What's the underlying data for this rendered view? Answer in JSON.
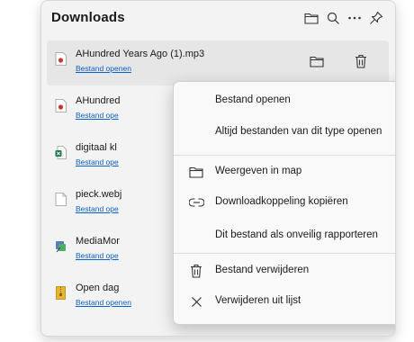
{
  "header": {
    "title": "Downloads",
    "open_folder_icon": "folder-icon",
    "search_icon": "search-icon",
    "more_icon": "more-icon",
    "pin_icon": "pin-icon"
  },
  "items": [
    {
      "name": "AHundred Years Ago (1).mp3",
      "link": "Bestand openen",
      "icon": "audio-file-icon",
      "color": "#c0392b"
    },
    {
      "name": "AHundred",
      "link": "Bestand ope",
      "icon": "audio-file-icon",
      "color": "#c0392b"
    },
    {
      "name": "digitaal kl",
      "link": "Bestand ope",
      "icon": "excel-file-icon",
      "color": "#1d7a45"
    },
    {
      "name": "pieck.webj",
      "link": "Bestand ope",
      "icon": "image-file-icon",
      "color": "#9a9a9a"
    },
    {
      "name": "MediaMor",
      "link": "Bestand ope",
      "icon": "installer-icon",
      "color": "#5a7bc0"
    },
    {
      "name": "Open dag",
      "link": "Bestand openen",
      "icon": "archive-file-icon",
      "color": "#d9a521"
    }
  ],
  "menu": {
    "open_file": "Bestand openen",
    "always_open": "Altijd bestanden van dit type openen",
    "show_in_folder": "Weergeven in map",
    "copy_link": "Downloadkoppeling kopiëren",
    "report_unsafe": "Dit bestand als onveilig rapporteren",
    "delete_file": "Bestand verwijderen",
    "remove_from_list": "Verwijderen uit lijst"
  }
}
